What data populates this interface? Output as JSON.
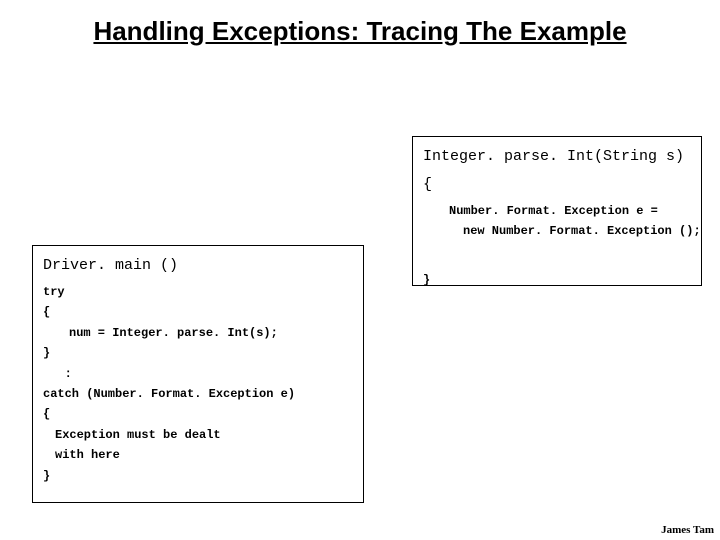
{
  "title": "Handling Exceptions: Tracing The Example",
  "right": {
    "header1": "Integer. parse. Int(String s)",
    "header2": "{",
    "line1": "Number. Format. Exception e =",
    "line2": "new Number. Format. Exception ();",
    "close": "}"
  },
  "left": {
    "header": "Driver. main ()",
    "l1": "try",
    "l2": "{",
    "l3": "num = Integer. parse. Int(s);",
    "l4": "}",
    "l5": "   :",
    "l6": "catch (Number. Format. Exception e)",
    "l7": "{",
    "l8": "Exception must be dealt",
    "l9": "with here",
    "l10": "}"
  },
  "footnote": "James Tam"
}
